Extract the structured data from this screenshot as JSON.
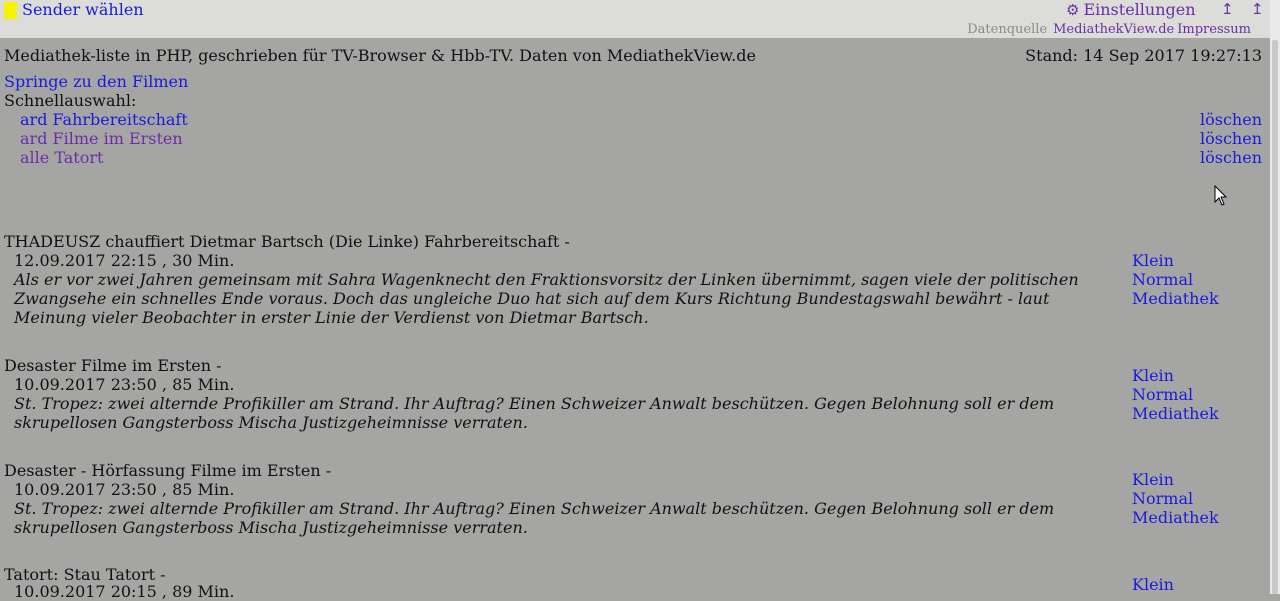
{
  "header": {
    "sender_link": "Sender wählen",
    "settings_link": "Einstellungen",
    "arrow_up": "↥",
    "arrow_down": "↥",
    "datasource_label": "Datenquelle",
    "datasource_link": "MediathekView.de",
    "impressum_link": "Impressum"
  },
  "info": {
    "description": "Mediathek-liste in PHP,  geschrieben für TV-Browser & Hbb-TV. Daten von MediathekView.de",
    "stand": "Stand: 14 Sep 2017 19:27:13"
  },
  "jump_link": "Springe zu den Filmen",
  "quick_select": {
    "label": "Schnellauswahl:",
    "items": [
      {
        "label": "ard Fahrbereitschaft",
        "delete": "löschen"
      },
      {
        "label": "ard Filme im Ersten",
        "delete": "löschen"
      },
      {
        "label": "alle Tatort",
        "delete": "löschen"
      }
    ]
  },
  "entries": [
    {
      "title": "THADEUSZ chauffiert Dietmar Bartsch (Die Linke) Fahrbereitschaft -",
      "meta": "12.09.2017 22:15 , 30 Min.",
      "description": "Als er vor zwei Jahren gemeinsam mit Sahra Wagenknecht den Fraktionsvorsitz der Linken übernimmt, sagen viele der politischen Zwangsehe ein schnelles Ende voraus. Doch das ungleiche Duo hat sich auf dem Kurs Richtung Bundestagswahl bewährt - laut Meinung vieler Beobachter in erster Linie der Verdienst von Dietmar Bartsch.",
      "links": [
        "Klein",
        "Normal",
        "Mediathek"
      ]
    },
    {
      "title": "Desaster Filme im Ersten -",
      "meta": "10.09.2017 23:50 , 85 Min.",
      "description": "St. Tropez: zwei alternde Profikiller am Strand. Ihr Auftrag? Einen Schweizer Anwalt beschützen. Gegen Belohnung soll er dem skrupellosen Gangsterboss Mischa Justizgeheimnisse verraten.",
      "links": [
        "Klein",
        "Normal",
        "Mediathek"
      ]
    },
    {
      "title": "Desaster - Hörfassung Filme im Ersten -",
      "meta": "10.09.2017 23:50 , 85 Min.",
      "description": "St. Tropez: zwei alternde Profikiller am Strand. Ihr Auftrag? Einen Schweizer Anwalt beschützen. Gegen Belohnung soll er dem skrupellosen Gangsterboss Mischa Justizgeheimnisse verraten.",
      "links": [
        "Klein",
        "Normal",
        "Mediathek"
      ]
    },
    {
      "title": "Tatort: Stau Tatort -",
      "meta": "10.09.2017 20:15 , 89 Min.",
      "links": [
        "Klein"
      ]
    }
  ]
}
